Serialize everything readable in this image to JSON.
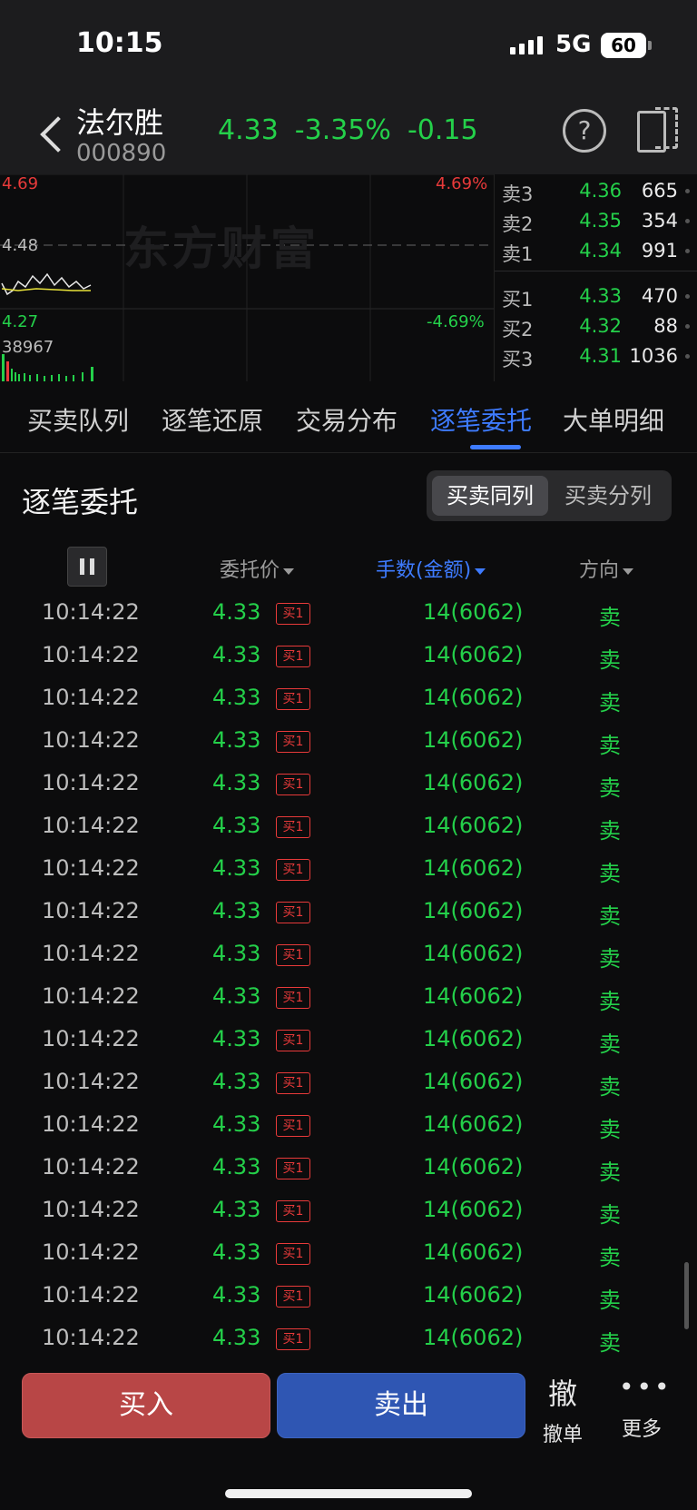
{
  "status_bar": {
    "time": "10:15",
    "network": "5G",
    "battery": "60"
  },
  "header": {
    "name": "法尔胜",
    "code": "000890",
    "price": "4.33",
    "change_pct": "-3.35%",
    "change": "-0.15"
  },
  "chart": {
    "watermark": "东方财富",
    "high": "4.69",
    "high_pct": "4.69%",
    "mid": "4.48",
    "low": "4.27",
    "low_pct": "-4.69%",
    "volume": "38967"
  },
  "order_book": {
    "asks": [
      {
        "label": "卖3",
        "price": "4.36",
        "vol": "665"
      },
      {
        "label": "卖2",
        "price": "4.35",
        "vol": "354"
      },
      {
        "label": "卖1",
        "price": "4.34",
        "vol": "991"
      }
    ],
    "bids": [
      {
        "label": "买1",
        "price": "4.33",
        "vol": "470"
      },
      {
        "label": "买2",
        "price": "4.32",
        "vol": "88"
      },
      {
        "label": "买3",
        "price": "4.31",
        "vol": "1036"
      }
    ]
  },
  "tabs": [
    "买卖队列",
    "逐笔还原",
    "交易分布",
    "逐笔委托",
    "大单明细"
  ],
  "active_tab": "逐笔委托",
  "section": {
    "title": "逐笔委托",
    "segment": [
      "买卖同列",
      "买卖分列"
    ],
    "segment_selected": "买卖同列"
  },
  "columns": {
    "price": "委托价",
    "qty": "手数(金额)",
    "dir": "方向"
  },
  "rows": [
    {
      "time": "10:14:22",
      "price": "4.33",
      "badge": "买1",
      "qty": "14(6062)",
      "dir": "卖"
    },
    {
      "time": "10:14:22",
      "price": "4.33",
      "badge": "买1",
      "qty": "14(6062)",
      "dir": "卖"
    },
    {
      "time": "10:14:22",
      "price": "4.33",
      "badge": "买1",
      "qty": "14(6062)",
      "dir": "卖"
    },
    {
      "time": "10:14:22",
      "price": "4.33",
      "badge": "买1",
      "qty": "14(6062)",
      "dir": "卖"
    },
    {
      "time": "10:14:22",
      "price": "4.33",
      "badge": "买1",
      "qty": "14(6062)",
      "dir": "卖"
    },
    {
      "time": "10:14:22",
      "price": "4.33",
      "badge": "买1",
      "qty": "14(6062)",
      "dir": "卖"
    },
    {
      "time": "10:14:22",
      "price": "4.33",
      "badge": "买1",
      "qty": "14(6062)",
      "dir": "卖"
    },
    {
      "time": "10:14:22",
      "price": "4.33",
      "badge": "买1",
      "qty": "14(6062)",
      "dir": "卖"
    },
    {
      "time": "10:14:22",
      "price": "4.33",
      "badge": "买1",
      "qty": "14(6062)",
      "dir": "卖"
    },
    {
      "time": "10:14:22",
      "price": "4.33",
      "badge": "买1",
      "qty": "14(6062)",
      "dir": "卖"
    },
    {
      "time": "10:14:22",
      "price": "4.33",
      "badge": "买1",
      "qty": "14(6062)",
      "dir": "卖"
    },
    {
      "time": "10:14:22",
      "price": "4.33",
      "badge": "买1",
      "qty": "14(6062)",
      "dir": "卖"
    },
    {
      "time": "10:14:22",
      "price": "4.33",
      "badge": "买1",
      "qty": "14(6062)",
      "dir": "卖"
    },
    {
      "time": "10:14:22",
      "price": "4.33",
      "badge": "买1",
      "qty": "14(6062)",
      "dir": "卖"
    },
    {
      "time": "10:14:22",
      "price": "4.33",
      "badge": "买1",
      "qty": "14(6062)",
      "dir": "卖"
    },
    {
      "time": "10:14:22",
      "price": "4.33",
      "badge": "买1",
      "qty": "14(6062)",
      "dir": "卖"
    },
    {
      "time": "10:14:22",
      "price": "4.33",
      "badge": "买1",
      "qty": "14(6062)",
      "dir": "卖"
    },
    {
      "time": "10:14:22",
      "price": "4.33",
      "badge": "买1",
      "qty": "14(6062)",
      "dir": "卖"
    }
  ],
  "bottom": {
    "buy": "买入",
    "sell": "卖出",
    "cancel_icon": "撤",
    "cancel": "撤单",
    "more": "更多"
  },
  "colors": {
    "up": "#e83a3a",
    "down": "#24d04a",
    "accent": "#3e7bff",
    "buy_button": "#b84646",
    "sell_button": "#2f56b3"
  }
}
